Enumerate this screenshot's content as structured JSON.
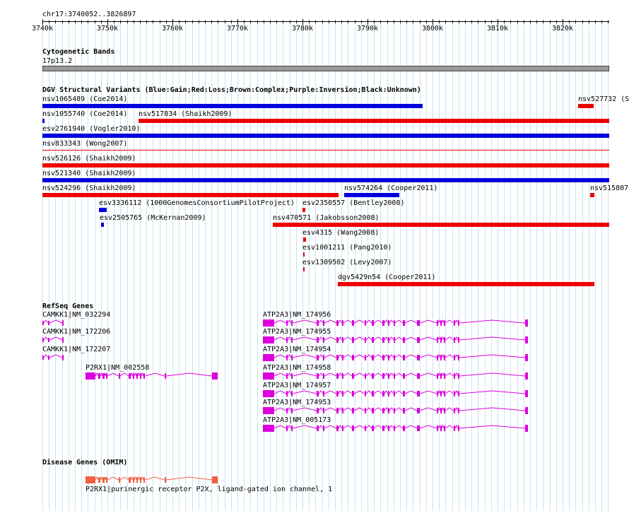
{
  "ruler": {
    "locus": "chr17:3740052..3826897",
    "ticks": [
      "3740k",
      "3750k",
      "3760k",
      "3770k",
      "3780k",
      "3790k",
      "3800k",
      "3810k",
      "3820k"
    ]
  },
  "cyto": {
    "title": "Cytogenetic Bands",
    "band": "17p13.2",
    "band_color": "#999999"
  },
  "dgv": {
    "title": "DGV Structural Variants (Blue:Gain;Red:Loss;Brown:Complex;Purple:Inversion;Black:Unknown)",
    "colors": {
      "gain": "#0000dd",
      "loss": "#ee0000"
    },
    "variants": [
      {
        "label": "nsv1065489 (Coe2014)"
      },
      {
        "label": "nsv527732 (S"
      },
      {
        "label": "nsv1055740 (Coe2014)"
      },
      {
        "label": "nsv517834 (Shaikh2009)"
      },
      {
        "label": "esv2761940 (Vogler2010)"
      },
      {
        "label": "nsv833343 (Wong2007)"
      },
      {
        "label": "nsv526126 (Shaikh2009)"
      },
      {
        "label": "nsv521340 (Shaikh2009)"
      },
      {
        "label": "nsv524296 (Shaikh2009)"
      },
      {
        "label": "nsv574264 (Cooper2011)"
      },
      {
        "label": "nsv515807"
      },
      {
        "label": "esv3336112 (1000GenomesConsortiumPilotProject)"
      },
      {
        "label": "esv2350557 (Bentley2008)"
      },
      {
        "label": "esv2505765 (McKernan2009)"
      },
      {
        "label": "nsv470571 (Jakobsson2008)"
      },
      {
        "label": "esv4315 (Wang2008)"
      },
      {
        "label": "esv1001211 (Pang2010)"
      },
      {
        "label": "esv1309502 (Levy2007)"
      },
      {
        "label": "dgv5429n54 (Cooper2011)"
      }
    ]
  },
  "refseq": {
    "title": "RefSeq Genes",
    "color": "#dd00dd",
    "genes": [
      {
        "label": "CAMKK1|NM_032294"
      },
      {
        "label": "CAMKK1|NM_172206"
      },
      {
        "label": "CAMKK1|NM_172207"
      },
      {
        "label": "P2RX1|NM_002558"
      },
      {
        "label": "ATP2A3|NM_174956"
      },
      {
        "label": "ATP2A3|NM_174955"
      },
      {
        "label": "ATP2A3|NM_174954"
      },
      {
        "label": "ATP2A3|NM_174958"
      },
      {
        "label": "ATP2A3|NM_174957"
      },
      {
        "label": "ATP2A3|NM_174953"
      },
      {
        "label": "ATP2A3|NM_005173"
      }
    ]
  },
  "omim": {
    "title": "Disease Genes (OMIM)",
    "color": "#f06040",
    "genes": [
      {
        "label": "P2RX1|purinergic receptor P2X, ligand-gated ion channel, 1"
      }
    ]
  }
}
